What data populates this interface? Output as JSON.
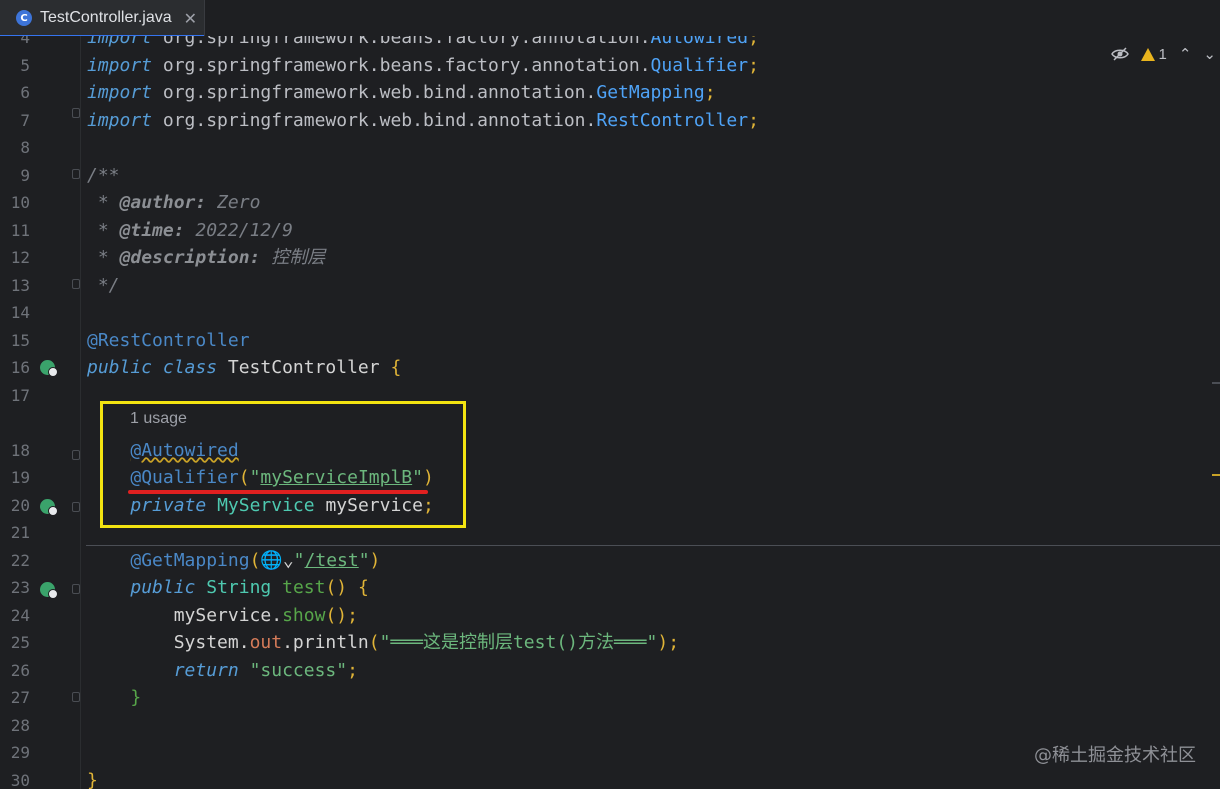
{
  "tab": {
    "icon_letter": "C",
    "label": "TestController.java",
    "close_glyph": "✕"
  },
  "hud": {
    "reader_icon": "eye-slash-icon",
    "warning_count": "1",
    "up": "⌃",
    "down": "⌄"
  },
  "lines": [
    {
      "n": "4",
      "parts": [
        [
          "kw",
          "import"
        ],
        [
          "pkg",
          " org.springframework.beans.factory.annotation."
        ],
        [
          "cls",
          "Autowired"
        ],
        [
          "semi",
          ";"
        ]
      ]
    },
    {
      "n": "5",
      "parts": [
        [
          "kw",
          "import"
        ],
        [
          "pkg",
          " org.springframework.beans.factory.annotation."
        ],
        [
          "cls",
          "Qualifier"
        ],
        [
          "semi",
          ";"
        ]
      ]
    },
    {
      "n": "6",
      "parts": [
        [
          "kw",
          "import"
        ],
        [
          "pkg",
          " org.springframework.web.bind.annotation."
        ],
        [
          "cls",
          "GetMapping"
        ],
        [
          "semi",
          ";"
        ]
      ]
    },
    {
      "n": "7",
      "parts": [
        [
          "kw",
          "import"
        ],
        [
          "pkg",
          " org.springframework.web.bind.annotation."
        ],
        [
          "cls",
          "RestController"
        ],
        [
          "semi",
          ";"
        ]
      ]
    },
    {
      "n": "8",
      "parts": []
    },
    {
      "n": "9",
      "parts": [
        [
          "cmt",
          "/**"
        ]
      ]
    },
    {
      "n": "10",
      "parts": [
        [
          "cmt",
          " * "
        ],
        [
          "tag",
          "@author:"
        ],
        [
          "cmt",
          " Zero"
        ]
      ]
    },
    {
      "n": "11",
      "parts": [
        [
          "cmt",
          " * "
        ],
        [
          "tag",
          "@time:"
        ],
        [
          "cmt",
          " 2022/12/9"
        ]
      ]
    },
    {
      "n": "12",
      "parts": [
        [
          "cmt",
          " * "
        ],
        [
          "tag",
          "@description:"
        ],
        [
          "cmt",
          " 控制层"
        ]
      ]
    },
    {
      "n": "13",
      "parts": [
        [
          "cmt",
          " */"
        ]
      ]
    },
    {
      "n": "14",
      "parts": []
    },
    {
      "n": "15",
      "parts": [
        [
          "ann",
          "@RestController"
        ]
      ]
    },
    {
      "n": "16",
      "parts": [
        [
          "kw",
          "public class"
        ],
        [
          "plain",
          " TestController "
        ],
        [
          "brace",
          "{"
        ]
      ]
    },
    {
      "n": "17",
      "parts": []
    },
    {
      "n": "18",
      "parts": [
        [
          "plain",
          "    "
        ],
        [
          "ann squiggle",
          "@Autowired"
        ]
      ]
    },
    {
      "n": "19",
      "parts": [
        [
          "plain",
          "    "
        ],
        [
          "ann",
          "@Qualifier"
        ],
        [
          "brace",
          "("
        ],
        [
          "str",
          "\""
        ],
        [
          "str u",
          "myServiceImplB"
        ],
        [
          "str",
          "\""
        ],
        [
          "brace",
          ")"
        ]
      ]
    },
    {
      "n": "20",
      "parts": [
        [
          "plain",
          "    "
        ],
        [
          "kw",
          "private"
        ],
        [
          "plain",
          " "
        ],
        [
          "type",
          "MyService"
        ],
        [
          "plain",
          " myService"
        ],
        [
          "semi",
          ";"
        ]
      ]
    },
    {
      "n": "21",
      "parts": []
    },
    {
      "n": "22",
      "parts": [
        [
          "plain",
          "    "
        ],
        [
          "ann",
          "@GetMapping"
        ],
        [
          "brace",
          "("
        ],
        [
          "plain",
          "🌐⌄"
        ],
        [
          "str",
          "\""
        ],
        [
          "str u",
          "/test"
        ],
        [
          "str",
          "\""
        ],
        [
          "brace",
          ")"
        ]
      ]
    },
    {
      "n": "23",
      "parts": [
        [
          "plain",
          "    "
        ],
        [
          "kw",
          "public"
        ],
        [
          "plain",
          " "
        ],
        [
          "type",
          "String"
        ],
        [
          "plain",
          " "
        ],
        [
          "method",
          "test"
        ],
        [
          "brace",
          "() {"
        ]
      ]
    },
    {
      "n": "24",
      "parts": [
        [
          "plain",
          "        myService."
        ],
        [
          "method",
          "show"
        ],
        [
          "brace",
          "()"
        ],
        [
          "semi",
          ";"
        ]
      ]
    },
    {
      "n": "25",
      "parts": [
        [
          "plain",
          "        System."
        ],
        [
          "field",
          "out"
        ],
        [
          "plain",
          ".println"
        ],
        [
          "brace",
          "("
        ],
        [
          "str",
          "\"═══这是控制层test()方法═══\""
        ],
        [
          "brace",
          ")"
        ],
        [
          "semi",
          ";"
        ]
      ]
    },
    {
      "n": "26",
      "parts": [
        [
          "plain",
          "        "
        ],
        [
          "kw",
          "return"
        ],
        [
          "plain",
          " "
        ],
        [
          "str",
          "\"success\""
        ],
        [
          "semi",
          ";"
        ]
      ]
    },
    {
      "n": "27",
      "parts": [
        [
          "plain",
          "    "
        ],
        [
          "method",
          "}"
        ]
      ]
    },
    {
      "n": "28",
      "parts": []
    },
    {
      "n": "29",
      "parts": []
    },
    {
      "n": "30",
      "parts": [
        [
          "brace",
          "}"
        ]
      ]
    }
  ],
  "usage_hint": "1 usage",
  "watermark": "@稀土掘金技术社区"
}
